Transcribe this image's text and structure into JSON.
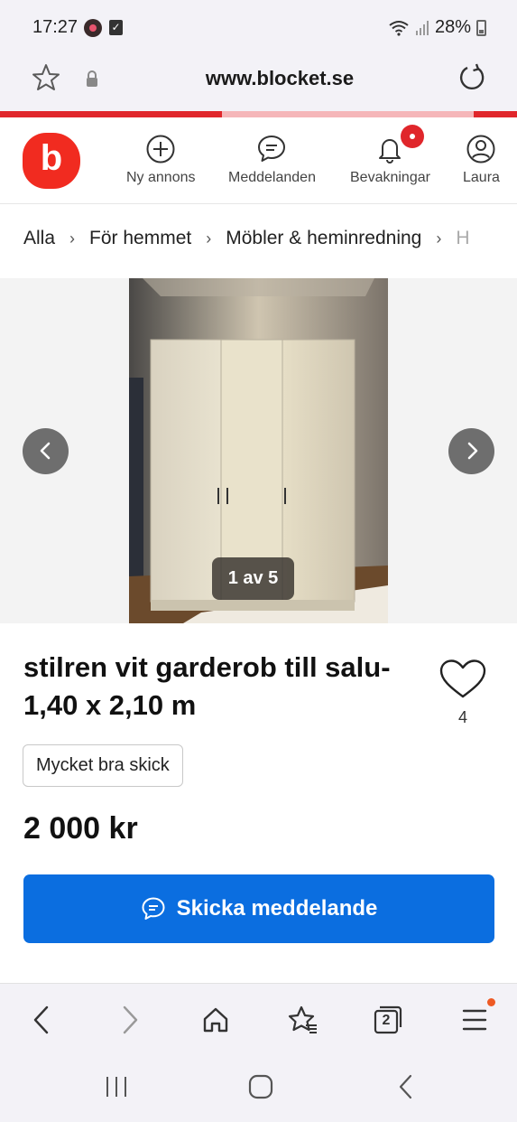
{
  "status_bar": {
    "time": "17:27",
    "battery": "28%"
  },
  "browser": {
    "url": "www.blocket.se",
    "tab_count": "2"
  },
  "header": {
    "logo_letter": "b",
    "nav": [
      {
        "label": "Ny annons",
        "icon": "plus-circle-icon"
      },
      {
        "label": "Meddelanden",
        "icon": "chat-bubble-icon"
      },
      {
        "label": "Bevakningar",
        "icon": "bell-icon"
      },
      {
        "label": "Laura",
        "icon": "user-icon"
      }
    ],
    "brand_color": "#f12b20"
  },
  "breadcrumb": {
    "items": [
      "Alla",
      "För hemmet",
      "Möbler & heminredning",
      "H"
    ]
  },
  "gallery": {
    "counter": "1 av 5"
  },
  "listing": {
    "title": "stilren vit garderob till salu- 1,40 x 2,10 m",
    "favorites_count": "4",
    "condition": "Mycket bra skick",
    "price": "2 000 kr"
  },
  "cta": {
    "label": "Skicka meddelande",
    "color": "#0b6ee0"
  }
}
